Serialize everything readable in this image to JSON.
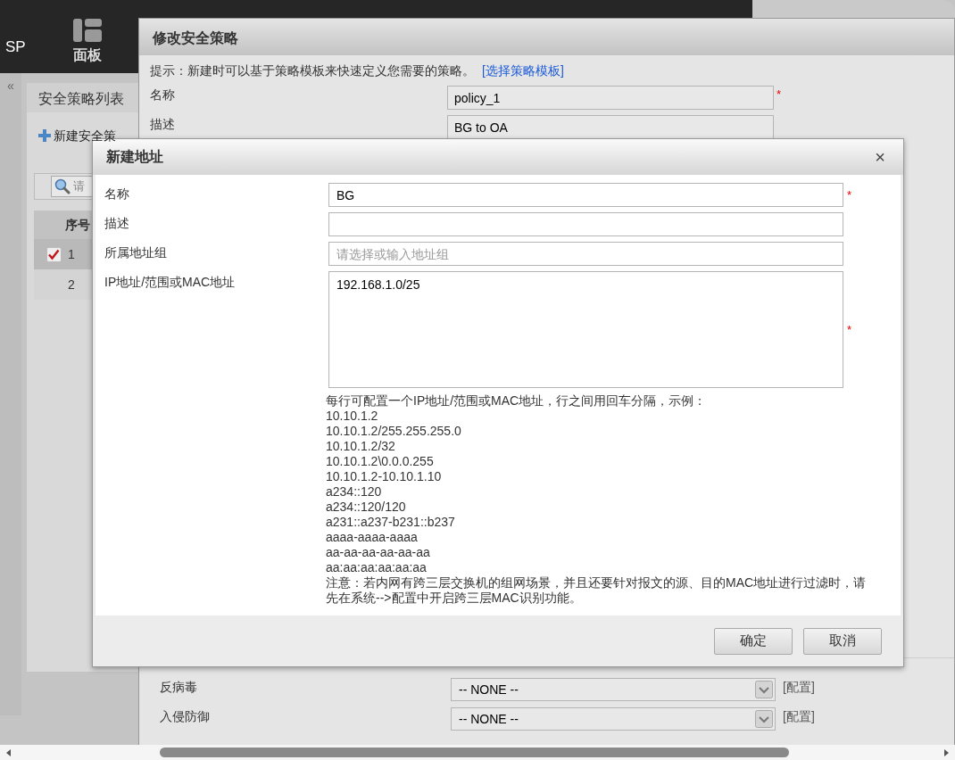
{
  "app": {
    "brand": "SP",
    "nav_tab": {
      "label": "面板",
      "selected": true
    }
  },
  "sidebar": {
    "collapse_glyph": "«",
    "panel_title": "安全策略列表",
    "new_button": "新建安全策",
    "search_placeholder": "请",
    "table": {
      "columns": [
        "序号"
      ],
      "rows": [
        {
          "index": "1",
          "checked": true,
          "selected": true
        },
        {
          "index": "2",
          "checked": false,
          "selected": false
        }
      ]
    }
  },
  "policy_dialog": {
    "title": "修改安全策略",
    "required_glyph": "*",
    "hint": "提示：新建时可以基于策略模板来快速定义您需要的策略。",
    "hint_link": "[选择策略模板]",
    "fields": [
      {
        "label": "名称",
        "value": "policy_1",
        "required": true
      },
      {
        "label": "描述",
        "value": "BG to OA",
        "required": false
      }
    ],
    "profiles": [
      {
        "label": "反病毒",
        "value": "-- NONE --",
        "link": "[配置]"
      },
      {
        "label": "入侵防御",
        "value": "-- NONE --",
        "link": "[配置]"
      }
    ]
  },
  "address_dialog": {
    "title": "新建地址",
    "close": "×",
    "required_glyph": "*",
    "fields": [
      {
        "kind": "input",
        "label": "名称",
        "value": "BG",
        "required": true
      },
      {
        "kind": "input",
        "label": "描述",
        "required": false
      },
      {
        "kind": "input",
        "label": "所属地址组",
        "placeholder": "请选择或输入地址组",
        "required": false
      },
      {
        "kind": "textarea",
        "label": "IP地址/范围或MAC地址",
        "value": "192.168.1.0/25",
        "required": true
      }
    ],
    "help_intro": "每行可配置一个IP地址/范围或MAC地址，行之间用回车分隔，示例：",
    "examples": [
      "10.10.1.2",
      "10.10.1.2/255.255.255.0",
      "10.10.1.2/32",
      "10.10.1.2\\0.0.0.255",
      "10.10.1.2-10.10.1.10",
      "a234::120",
      "a234::120/120",
      "a231::a237-b231::b237",
      "aaaa-aaaa-aaaa",
      "aa-aa-aa-aa-aa-aa",
      "aa:aa:aa:aa:aa:aa"
    ],
    "note": "注意：若内网有跨三层交换机的组网场景，并且还要针对报文的源、目的MAC地址进行过滤时，请先在系统-->配置中开启跨三层MAC识别功能。",
    "buttons": [
      "确定",
      "取消"
    ]
  }
}
